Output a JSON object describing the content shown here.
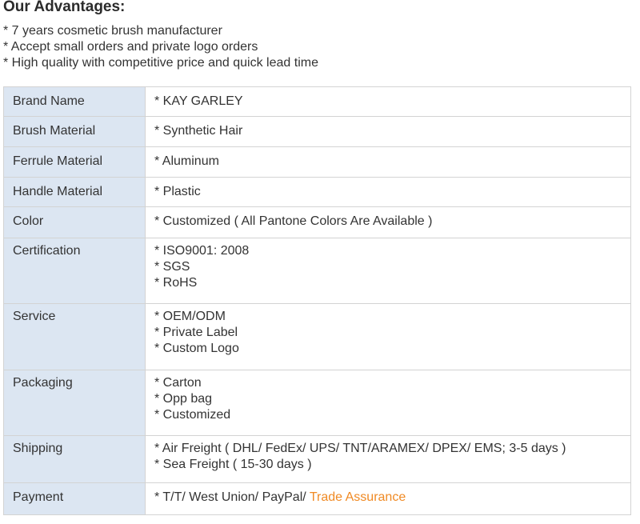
{
  "heading": "Our Advantages:",
  "advantages": [
    "* 7 years cosmetic brush manufacturer",
    "* Accept small orders and private logo orders",
    "* High quality with competitive price and quick lead time"
  ],
  "specs": [
    {
      "label": "Brand Name",
      "lines": [
        "* KAY GARLEY"
      ]
    },
    {
      "label": "Brush Material",
      "lines": [
        "* Synthetic Hair"
      ]
    },
    {
      "label": "Ferrule Material",
      "lines": [
        "* Aluminum"
      ]
    },
    {
      "label": "Handle Material",
      "lines": [
        "* Plastic"
      ]
    },
    {
      "label": "Color",
      "lines": [
        "* Customized ( All Pantone Colors Are Available )"
      ]
    },
    {
      "label": "Certification",
      "lines": [
        "* ISO9001: 2008",
        "* SGS",
        "* RoHS"
      ]
    },
    {
      "label": "Service",
      "lines": [
        "* OEM/ODM",
        "* Private Label",
        "* Custom Logo"
      ]
    },
    {
      "label": "Packaging",
      "lines": [
        "* Carton",
        "* Opp bag",
        "* Customized"
      ]
    },
    {
      "label": "Shipping",
      "lines": [
        "* Air Freight ( DHL/ FedEx/ UPS/ TNT/ARAMEX/ DPEX/ EMS; 3-5 days )",
        "* Sea Freight ( 15-30 days )"
      ]
    },
    {
      "label": "Payment",
      "lines": [
        "* T/T/ West Union/ PayPal/ "
      ],
      "highlight": "Trade Assurance"
    }
  ],
  "colors": {
    "label_background": "#dce6f2",
    "border": "#d3d3d3",
    "highlight": "#f08a24"
  }
}
